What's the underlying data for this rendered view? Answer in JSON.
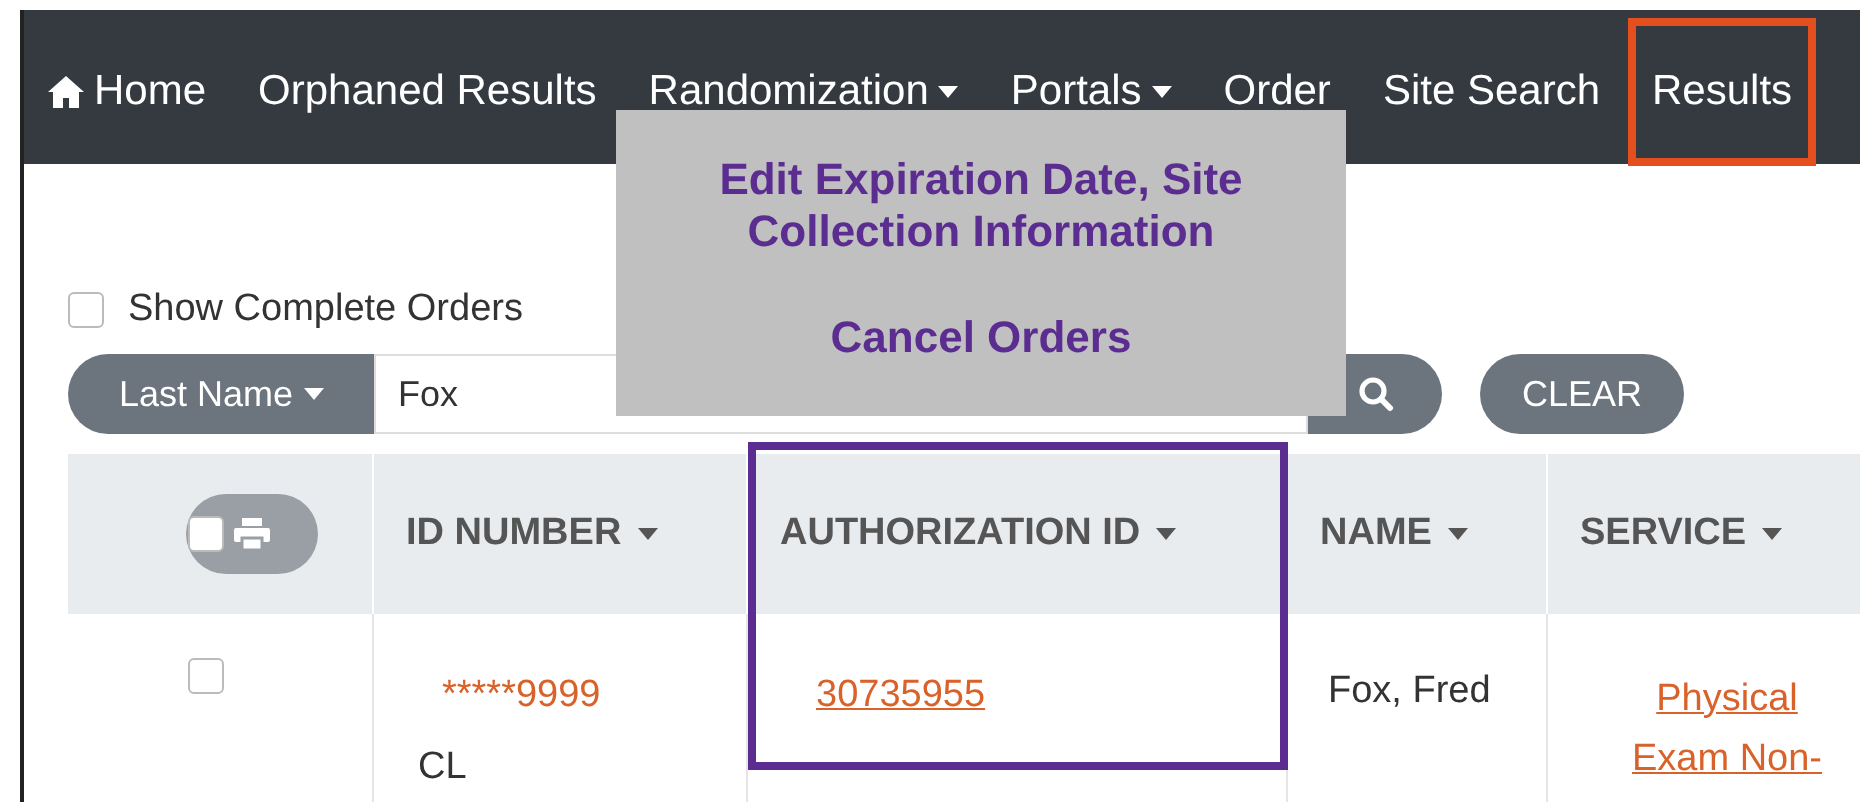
{
  "nav": [
    {
      "kind": "home",
      "label": "Home",
      "caret": false,
      "highlighted": false
    },
    {
      "kind": "link",
      "label": "Orphaned Results",
      "caret": false,
      "highlighted": false
    },
    {
      "kind": "link",
      "label": "Randomization",
      "caret": true,
      "highlighted": false
    },
    {
      "kind": "link",
      "label": "Portals",
      "caret": true,
      "highlighted": false
    },
    {
      "kind": "link",
      "label": "Order",
      "caret": false,
      "highlighted": false
    },
    {
      "kind": "link",
      "label": "Site Search",
      "caret": false,
      "highlighted": false
    },
    {
      "kind": "link",
      "label": "Results",
      "caret": false,
      "highlighted": true
    }
  ],
  "callout": {
    "lines": [
      "Edit Expiration Date, Site Collection Information",
      "Cancel Orders"
    ]
  },
  "show_complete_orders": {
    "label": "Show Complete Orders",
    "checked": false
  },
  "search": {
    "field_menu": "Last Name",
    "value": "Fox",
    "clear": "CLEAR"
  },
  "table": {
    "select_all": {
      "checked": false
    },
    "columns": [
      {
        "label": "ID NUMBER",
        "highlighted": false
      },
      {
        "label": "AUTHORIZATION ID",
        "highlighted": true
      },
      {
        "label": "NAME",
        "highlighted": false
      },
      {
        "label": "SERVICE",
        "highlighted": false
      }
    ],
    "rows": [
      {
        "checked": false,
        "id_number": "*****9999",
        "id_suffix": "CL",
        "authorization_id": "30735955",
        "name": "Fox, Fred",
        "service": "Physical Exam Non-"
      }
    ]
  }
}
